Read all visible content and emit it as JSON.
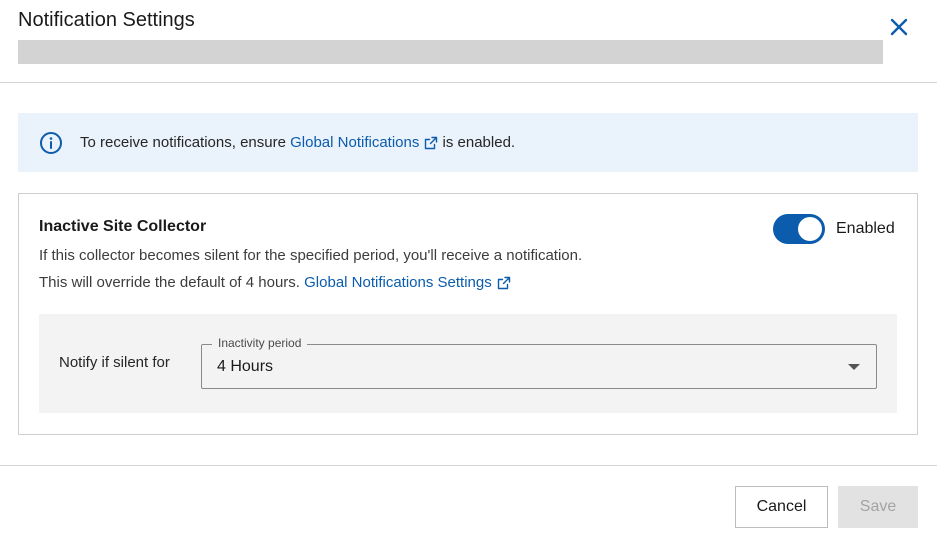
{
  "dialog": {
    "title": "Notification Settings",
    "close_icon": "close-icon"
  },
  "banner": {
    "icon": "info-icon",
    "text_before": "To receive notifications, ensure",
    "link_text": "Global Notifications",
    "text_after": "is enabled."
  },
  "collector": {
    "title": "Inactive Site Collector",
    "description": "If this collector becomes silent for the specified period, you'll receive a notification.",
    "override_text": "This will override the default of 4 hours.",
    "settings_link": "Global Notifications Settings",
    "toggle_label": "Enabled",
    "toggle_on": true
  },
  "period": {
    "label": "Notify if silent for",
    "select_legend": "Inactivity period",
    "select_value": "4 Hours"
  },
  "footer": {
    "cancel_label": "Cancel",
    "save_label": "Save"
  },
  "colors": {
    "accent": "#0b5cad",
    "banner_bg": "#eaf2fb",
    "panel_bg": "#f3f3f3"
  }
}
